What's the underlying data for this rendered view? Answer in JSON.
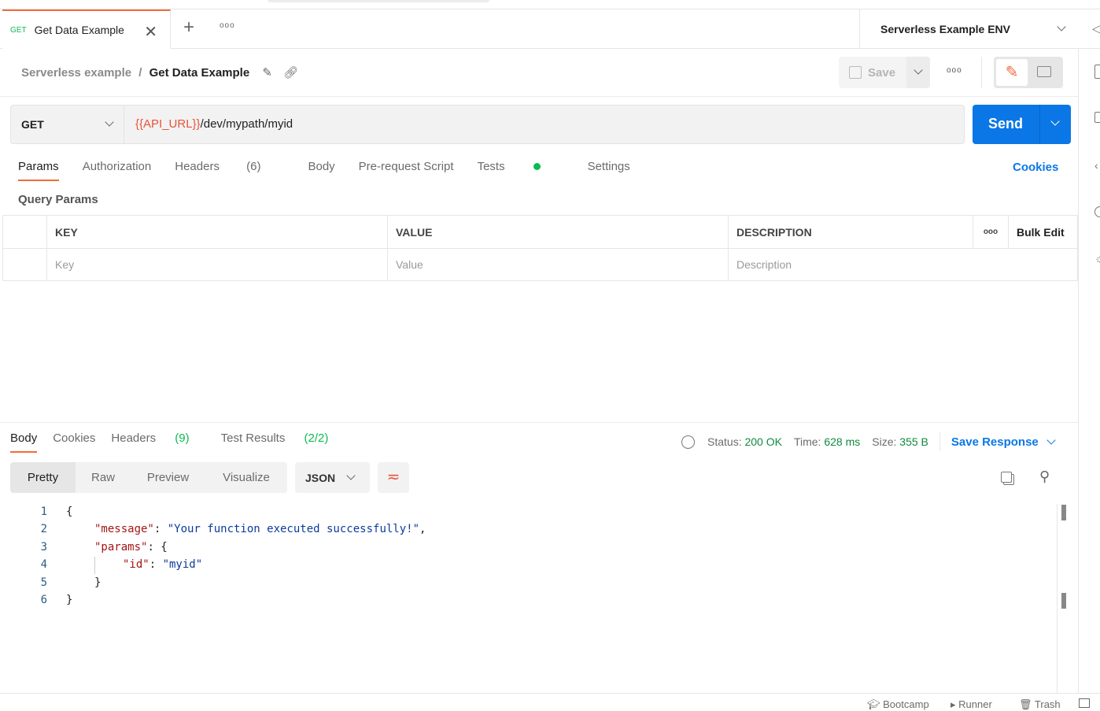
{
  "tab": {
    "method": "GET",
    "title": "Get Data Example"
  },
  "environment": "Serverless Example ENV",
  "breadcrumb": {
    "collection": "Serverless example",
    "separator": "/",
    "request": "Get Data Example"
  },
  "toolbar": {
    "save_label": "Save"
  },
  "request": {
    "method": "GET",
    "url_var": "{{API_URL}}",
    "url_path": "/dev/mypath/myid",
    "send_label": "Send"
  },
  "req_tabs": {
    "params": "Params",
    "authorization": "Authorization",
    "headers": "Headers",
    "headers_count": "(6)",
    "body": "Body",
    "prerequest": "Pre-request Script",
    "tests": "Tests",
    "settings": "Settings",
    "cookies": "Cookies"
  },
  "query_params": {
    "title": "Query Params",
    "headers": [
      "KEY",
      "VALUE",
      "DESCRIPTION"
    ],
    "bulk_edit": "Bulk Edit",
    "placeholders": [
      "Key",
      "Value",
      "Description"
    ]
  },
  "response": {
    "tabs": {
      "body": "Body",
      "cookies": "Cookies",
      "headers": "Headers",
      "headers_count": "(9)",
      "tests": "Test Results",
      "tests_count": "(2/2)"
    },
    "status_label": "Status:",
    "status": "200 OK",
    "time_label": "Time:",
    "time": "628 ms",
    "size_label": "Size:",
    "size": "355 B",
    "save_response": "Save Response",
    "views": [
      "Pretty",
      "Raw",
      "Preview",
      "Visualize"
    ],
    "format": "JSON",
    "code": [
      [
        {
          "t": "{",
          "c": "p"
        }
      ],
      [
        {
          "t": "\"message\"",
          "c": "k"
        },
        {
          "t": ": ",
          "c": "p"
        },
        {
          "t": "\"Your function executed successfully!\"",
          "c": "s"
        },
        {
          "t": ",",
          "c": "p"
        }
      ],
      [
        {
          "t": "\"params\"",
          "c": "k"
        },
        {
          "t": ": {",
          "c": "p"
        }
      ],
      [
        {
          "t": "\"id\"",
          "c": "k"
        },
        {
          "t": ": ",
          "c": "p"
        },
        {
          "t": "\"myid\"",
          "c": "s"
        }
      ],
      [
        {
          "t": "}",
          "c": "p"
        }
      ],
      [
        {
          "t": "}",
          "c": "p"
        }
      ]
    ]
  },
  "footer": {
    "bootcamp": "Bootcamp",
    "runner": "Runner",
    "trash": "Trash"
  }
}
